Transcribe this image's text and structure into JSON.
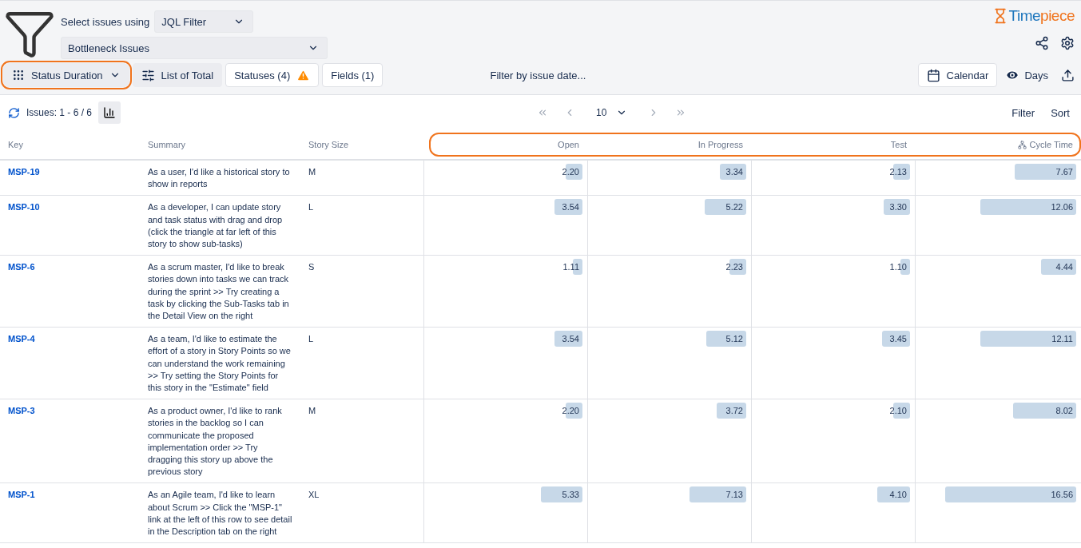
{
  "header": {
    "source_label": "Select issues using",
    "source_select": "JQL Filter",
    "filter_select": "Bottleneck Issues",
    "logo": {
      "lead": "Time",
      "tail": "piece"
    }
  },
  "toolbar": {
    "view": {
      "label": "Status Duration",
      "highlighted": true
    },
    "buttons": [
      {
        "kind": "list",
        "label": "List of Total"
      },
      {
        "kind": "statuses",
        "label": "Statuses (4)",
        "warning": true
      },
      {
        "kind": "fields",
        "label": "Fields (1)"
      }
    ],
    "date_filter": "Filter by issue date...",
    "calendar": "Calendar",
    "days": "Days"
  },
  "table_bar": {
    "count": "Issues: 1 - 6 / 6",
    "page_size": "10",
    "filter": "Filter",
    "sort": "Sort"
  },
  "table": {
    "duration_columns_highlighted": true,
    "columns": [
      {
        "kind": "key",
        "label": "Key"
      },
      {
        "kind": "text",
        "label": "Summary"
      },
      {
        "kind": "text",
        "label": "Story Size"
      },
      {
        "kind": "duration",
        "label": "Open"
      },
      {
        "kind": "duration",
        "label": "In Progress"
      },
      {
        "kind": "duration",
        "label": "Test"
      },
      {
        "kind": "total",
        "label": "Cycle Time"
      }
    ],
    "rows": [
      {
        "key": "MSP-19",
        "summary": "As a user, I'd like a historical story to show in reports",
        "story_size": "M",
        "durations": [
          {
            "value": "2.20",
            "level": 0.11
          },
          {
            "value": "3.34",
            "level": 0.17
          },
          {
            "value": "2.13",
            "level": 0.11
          },
          {
            "value": "7.67",
            "level": 0.4
          }
        ]
      },
      {
        "key": "MSP-10",
        "summary": "As a developer, I can update story and task status with drag and drop (click the triangle at far left of this story to show sub-tasks)",
        "story_size": "L",
        "durations": [
          {
            "value": "3.54",
            "level": 0.18
          },
          {
            "value": "5.22",
            "level": 0.27
          },
          {
            "value": "3.30",
            "level": 0.17
          },
          {
            "value": "12.06",
            "level": 0.62
          }
        ]
      },
      {
        "key": "MSP-6",
        "summary": "As a scrum master, I'd like to break stories down into tasks we can track during the sprint >> Try creating a task by clicking the Sub-Tasks tab in the Detail View on the right",
        "story_size": "S",
        "durations": [
          {
            "value": "1.11",
            "level": 0.06
          },
          {
            "value": "2.23",
            "level": 0.11
          },
          {
            "value": "1.10",
            "level": 0.06
          },
          {
            "value": "4.44",
            "level": 0.23
          }
        ]
      },
      {
        "key": "MSP-4",
        "summary": "As a team, I'd like to estimate the effort of a story in Story Points so we can understand the work remaining >> Try setting the Story Points for this story in the \"Estimate\" field",
        "story_size": "L",
        "durations": [
          {
            "value": "3.54",
            "level": 0.18
          },
          {
            "value": "5.12",
            "level": 0.26
          },
          {
            "value": "3.45",
            "level": 0.18
          },
          {
            "value": "12.11",
            "level": 0.62
          }
        ]
      },
      {
        "key": "MSP-3",
        "summary": "As a product owner, I'd like to rank stories in the backlog so I can communicate the proposed implementation order >> Try dragging this story up above the previous story",
        "story_size": "M",
        "durations": [
          {
            "value": "2.20",
            "level": 0.11
          },
          {
            "value": "3.72",
            "level": 0.19
          },
          {
            "value": "2.10",
            "level": 0.11
          },
          {
            "value": "8.02",
            "level": 0.41
          }
        ]
      },
      {
        "key": "MSP-1",
        "summary": "As an Agile team, I'd like to learn about Scrum >> Click the \"MSP-1\" link at the left of this row to see detail in the Description tab on the right",
        "story_size": "XL",
        "durations": [
          {
            "value": "5.33",
            "level": 0.27
          },
          {
            "value": "7.13",
            "level": 0.37
          },
          {
            "value": "4.10",
            "level": 0.21
          },
          {
            "value": "16.56",
            "level": 0.85
          }
        ]
      }
    ]
  }
}
